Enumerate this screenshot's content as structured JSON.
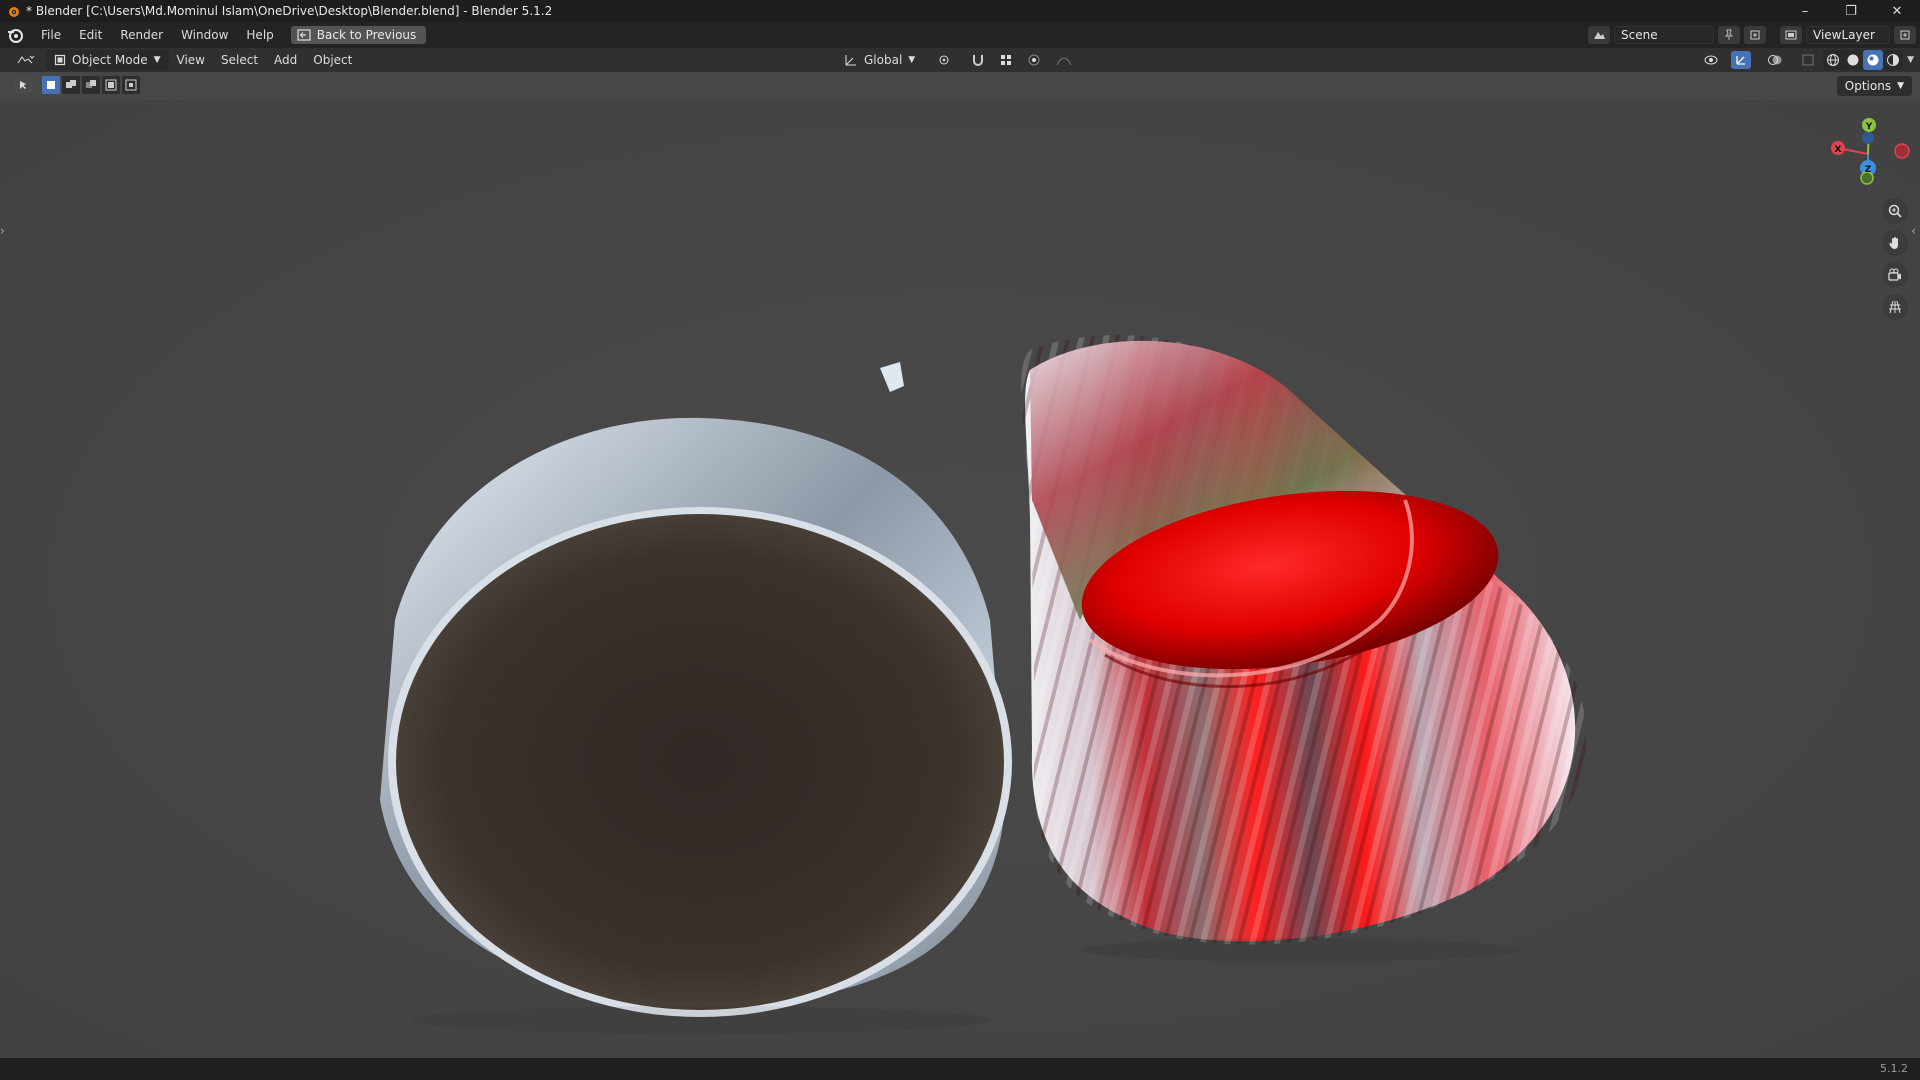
{
  "window": {
    "title": "* Blender [C:\\Users\\Md.Mominul Islam\\OneDrive\\Desktop\\Blender.blend] - Blender 5.1.2",
    "controls": [
      "minimize-icon",
      "restore-icon",
      "close-icon"
    ]
  },
  "menubar": {
    "items": [
      "File",
      "Edit",
      "Render",
      "Window",
      "Help"
    ],
    "back_button": "Back to Previous",
    "scene_label": "Scene",
    "viewlayer_label": "ViewLayer"
  },
  "header": {
    "mode": "Object Mode",
    "menus": [
      "View",
      "Select",
      "Add",
      "Object"
    ],
    "orientation": "Global"
  },
  "tools": {
    "options_label": "Options"
  },
  "gizmo": {
    "x_label": "X",
    "y_label": "Y",
    "z_label": "Z"
  },
  "status": {
    "version": "5.1.2"
  },
  "colors": {
    "accent": "#4772b3",
    "viewport_bg": "#474747",
    "axis_x": "#e0424e",
    "axis_y": "#8bc53f",
    "axis_z": "#3f8fe0"
  }
}
